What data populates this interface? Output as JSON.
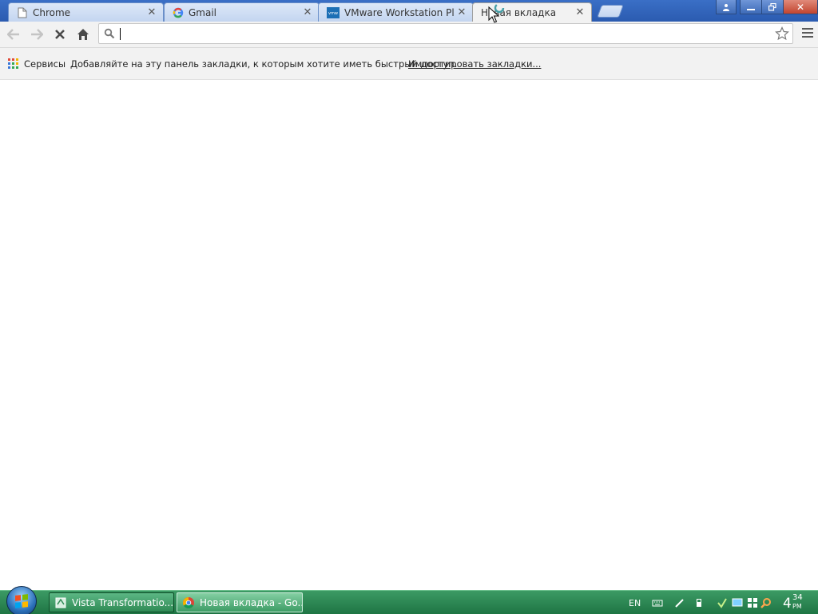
{
  "window": {
    "tabs": [
      {
        "title": "Chrome",
        "favicon": "page-icon"
      },
      {
        "title": "Gmail",
        "favicon": "google-icon"
      },
      {
        "title": "VMware Workstation Player",
        "favicon": "vmware-icon"
      },
      {
        "title": "Новая вкладка",
        "favicon": "loading-icon",
        "active": true
      }
    ],
    "controls": {
      "user_icon": "user-icon",
      "minimize_icon": "minimize-icon",
      "restore_icon": "restore-icon",
      "close_icon": "close-icon"
    }
  },
  "toolbar": {
    "back_icon": "back-arrow-icon",
    "forward_icon": "forward-arrow-icon",
    "stop_icon": "stop-icon",
    "home_icon": "home-icon",
    "omnibox_value": "",
    "search_icon": "search-icon",
    "star_icon": "star-icon",
    "menu_icon": "menu-icon"
  },
  "bookmarks": {
    "apps_label": "Сервисы",
    "hint": "Добавляйте на эту панель закладки, к которым хотите иметь быстрый доступ.",
    "import_link": "Импортировать закладки..."
  },
  "taskbar": {
    "tasks": [
      {
        "label": "Vista Transformatio...",
        "icon": "vista-transformation-icon"
      },
      {
        "label": "Новая вкладка - Go...",
        "icon": "chrome-icon",
        "active": true
      }
    ],
    "language": "EN",
    "tray_icons": [
      "keyboard-icon",
      "pen-icon",
      "usb-icon",
      "network-icon",
      "monitor-icon",
      "search-icon"
    ],
    "clock": {
      "hour": "4",
      "minute": "34",
      "ampm": "PM"
    }
  },
  "colors": {
    "tab_strip": "#2b5bb0",
    "toolbar": "#f2f2f2",
    "taskbar": "#2f8a55"
  }
}
